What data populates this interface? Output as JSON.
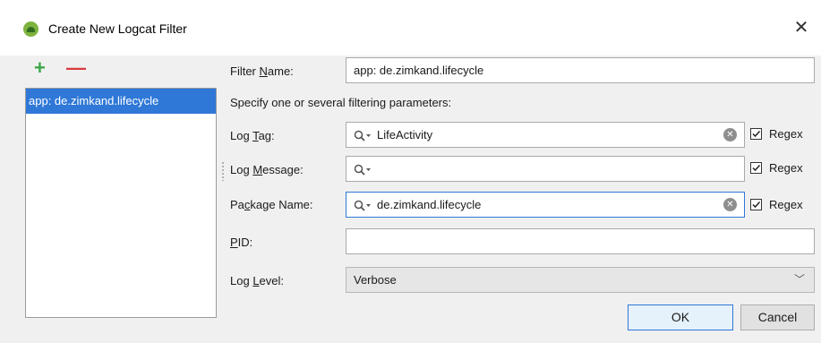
{
  "dialog": {
    "title": "Create New Logcat Filter",
    "close": "✕"
  },
  "filters": {
    "items": [
      "app: de.zimkand.lifecycle"
    ],
    "add": "+",
    "remove": "—"
  },
  "form": {
    "filter_name": {
      "label_pre": "Filter ",
      "label_key": "N",
      "label_post": "ame:",
      "value": "app: de.zimkand.lifecycle"
    },
    "hint": "Specify one or several filtering parameters:",
    "log_tag": {
      "label_pre": "Log ",
      "label_key": "T",
      "label_post": "ag:",
      "value": "LifeActivity",
      "regex": "Regex",
      "regex_checked": true
    },
    "log_message": {
      "label_pre": "Log ",
      "label_key": "M",
      "label_post": "essage:",
      "value": "",
      "regex": "Regex",
      "regex_checked": true
    },
    "package_name": {
      "label_pre": "Pa",
      "label_key": "c",
      "label_post": "kage Name:",
      "value": "de.zimkand.lifecycle",
      "regex": "Regex",
      "regex_checked": true
    },
    "pid": {
      "label_pre": "",
      "label_key": "P",
      "label_post": "ID:",
      "value": ""
    },
    "log_level": {
      "label_pre": "Log ",
      "label_key": "L",
      "label_post": "evel:",
      "value": "Verbose"
    }
  },
  "buttons": {
    "ok": "OK",
    "cancel": "Cancel"
  },
  "colors": {
    "accent": "#2f78d7",
    "add": "#3aa84a",
    "remove": "#d83b3b"
  }
}
